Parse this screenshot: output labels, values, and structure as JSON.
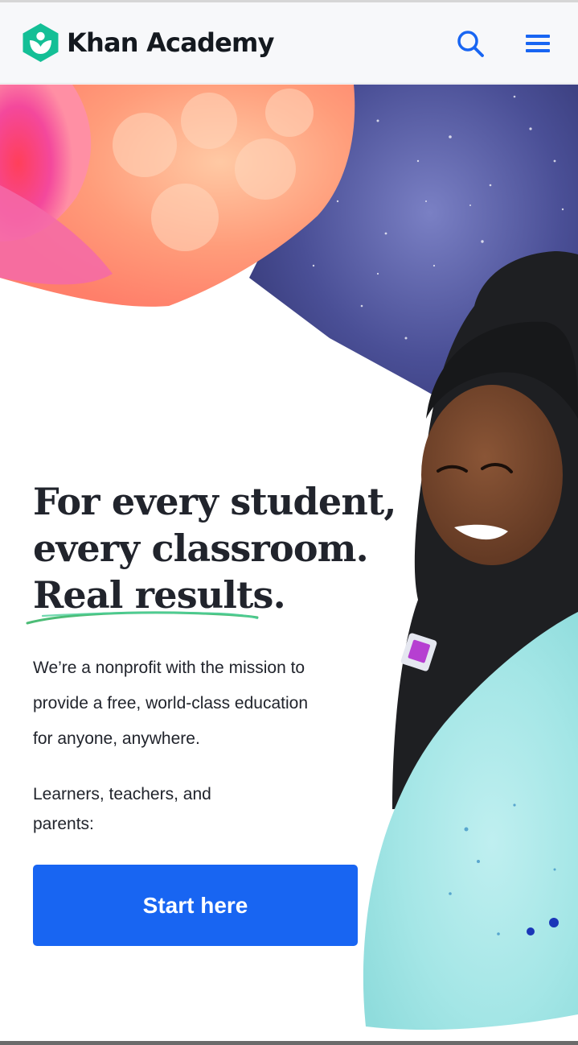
{
  "header": {
    "brand_name": "Khan Academy",
    "logo_icon": "khan-academy-hexagon-leaf",
    "search_icon": "search-icon",
    "menu_icon": "hamburger-menu-icon"
  },
  "hero": {
    "title_lines": [
      "For every student,",
      "every classroom.",
      "Real results."
    ],
    "mission_lines": [
      "We’re a nonprofit with the mission to",
      "provide a free, world-class education",
      "for anyone, anywhere."
    ],
    "audience_lines": [
      "Learners, teachers, and",
      "parents:"
    ],
    "cta_label": "Start here"
  },
  "colors": {
    "brand_green": "#14bf96",
    "primary_blue": "#1865f2",
    "text_dark": "#21242c",
    "underline_green": "#1fab54"
  }
}
